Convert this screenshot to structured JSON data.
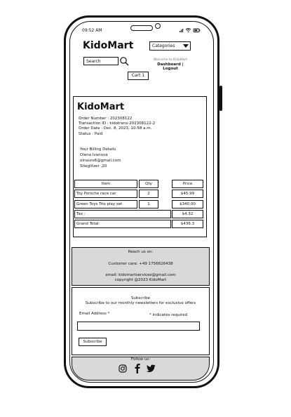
{
  "status_bar": {
    "time": "09:52 AM"
  },
  "header": {
    "logo": "KidoMart",
    "categories_label": "Categories",
    "search_placeholder": "Search",
    "welcome_text": "Welcome to KidoMart",
    "dashboard_link": "Dashboard",
    "separator": "|",
    "logout_link": "Logout",
    "cart_label": "Cart 1"
  },
  "receipt": {
    "logo": "KidoMart",
    "order_number": "Order Number : 202308122",
    "transaction_id": "Transaction ID : kidotrans-202308122-2",
    "order_date": "Order Date : Dec. 8, 2023, 10:58 a.m.",
    "status": "Status : Paid",
    "billing_heading": "Your Billing Details",
    "billing_name": "Olena Ivanova",
    "billing_email": "olnauro6@gmail.com",
    "billing_address": "Stieglitzer ,20",
    "table": {
      "headers": [
        "Item",
        "Qty",
        "Price"
      ],
      "rows": [
        {
          "item": "Toy Porsche race car",
          "qty": "2",
          "price": "$45.99"
        },
        {
          "item": "Green Toys Trio play set",
          "qty": "1",
          "price": "$340.00"
        }
      ],
      "tax_label": "Tax :",
      "tax_value": "$4.32",
      "grand_total_label": "Grand Total:",
      "grand_total_value": "$436.3"
    }
  },
  "footer": {
    "reach_heading": "Reach us on:",
    "customer_care": "Customer care: +49 1756626438",
    "email": "email: kidomartservices@gmail.com",
    "copyright": "copyright @2023 KidoMart",
    "subscribe_heading": "Subscribe",
    "subscribe_text": "Subscribe to our monthly newsletters for exclusive offers",
    "email_label": "Email Address *",
    "required_note": "* indicates required",
    "subscribe_button": "Subscribe",
    "follow_label": "Follow us:",
    "social_icons": [
      "instagram-icon",
      "facebook-icon",
      "twitter-icon"
    ]
  }
}
